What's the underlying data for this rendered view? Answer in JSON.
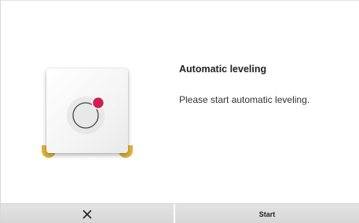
{
  "dialog": {
    "title": "Automatic leveling",
    "message": "Please start automatic leveling."
  },
  "illustration": {
    "icon": "leveling-plate-icon",
    "accent_color": "#d0204f",
    "foot_color": "#e0b43c"
  },
  "buttons": {
    "cancel_icon": "close-icon",
    "start_label": "Start"
  }
}
